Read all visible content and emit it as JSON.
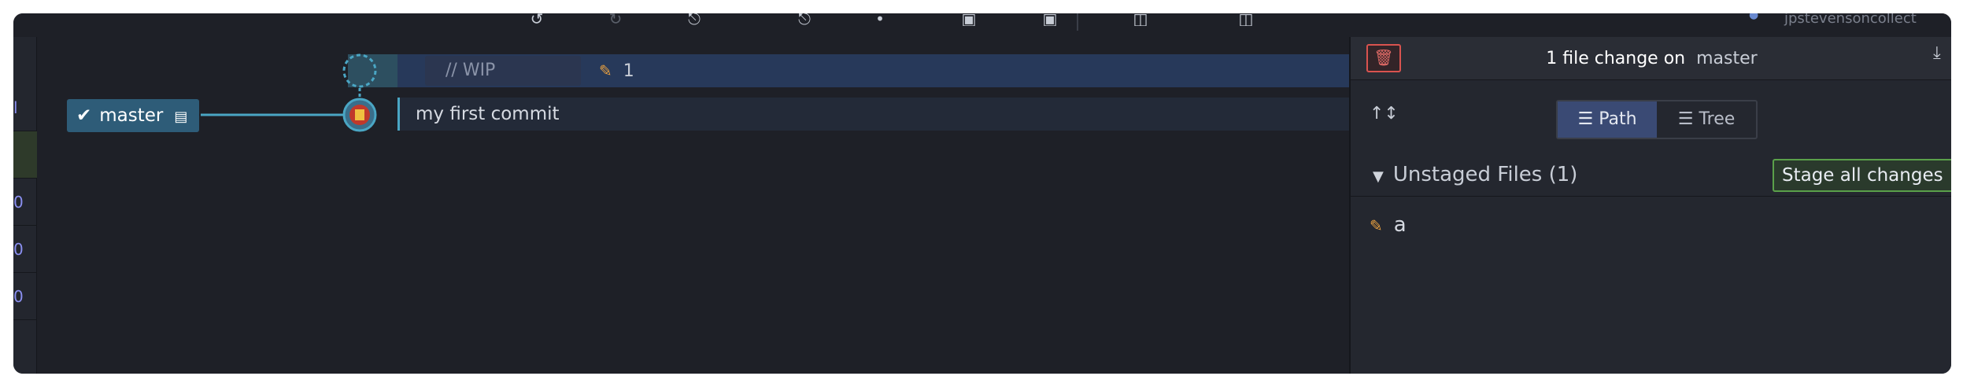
{
  "toolbar": {
    "icons": [
      "undo-icon",
      "redo-icon",
      "fetch-icon",
      "pull-icon",
      "push-icon",
      "branch-icon",
      "stash-icon",
      "pop-icon",
      "terminal-icon",
      "actions-icon"
    ],
    "user_label": "jpstevensoncollect"
  },
  "rail": {
    "items": [
      "l",
      "",
      "0",
      "0",
      "0"
    ]
  },
  "graph": {
    "wip": {
      "placeholder": "// WIP",
      "change_count": "1"
    },
    "commits": [
      {
        "message": "my first commit"
      }
    ],
    "branch": {
      "name": "master",
      "is_checked_out": true
    },
    "colors": {
      "lane": "#4aa6c4",
      "avatar": "#c0392b"
    }
  },
  "panel": {
    "header": {
      "summary": "1 file change on",
      "branch": "master"
    },
    "views": {
      "path_label": "Path",
      "tree_label": "Tree",
      "selected": "Path"
    },
    "unstaged": {
      "title": "Unstaged Files (1)",
      "stage_all_label": "Stage all changes",
      "files": [
        {
          "name": "a",
          "status": "modified"
        }
      ]
    }
  }
}
